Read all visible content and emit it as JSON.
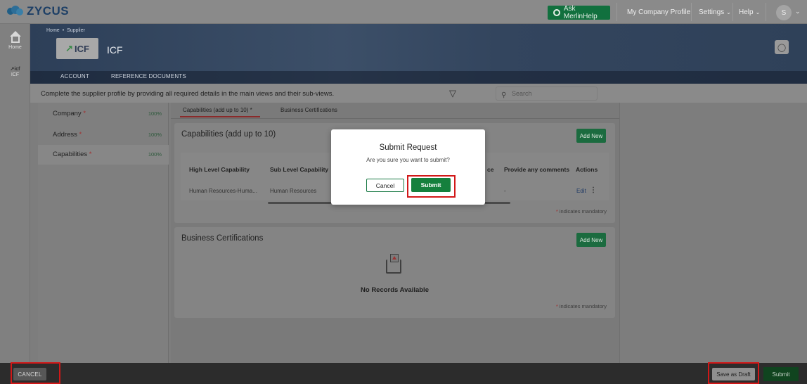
{
  "app": {
    "logo_text": "ZYCUS",
    "ask_button": "Ask MerlinHelp",
    "nav": {
      "profile": "My Company Profile",
      "settings": "Settings",
      "help": "Help"
    },
    "avatar_initial": "S"
  },
  "rail": {
    "home_label": "Home",
    "icf_label": "ICF"
  },
  "banner": {
    "breadcrumb": [
      "Home",
      "Supplier"
    ],
    "company_logo_text": "ICF",
    "company_name": "ICF",
    "tabs": [
      "ACCOUNT",
      "REFERENCE DOCUMENTS"
    ]
  },
  "instruction": {
    "text": "Complete the supplier profile by providing all required details in the main views and their sub-views.",
    "search_placeholder": "Search"
  },
  "sidebar": {
    "items": [
      {
        "label": "Company",
        "required": "*",
        "percent": "100%"
      },
      {
        "label": "Address",
        "required": "*",
        "percent": "100%"
      },
      {
        "label": "Capabilities",
        "required": "*",
        "percent": "100%"
      }
    ]
  },
  "subtabs": [
    "Capabilities (add up to 10) *",
    "Business Certifications"
  ],
  "capabilities": {
    "title": "Capabilities (add up to 10)",
    "add_new": "Add New",
    "columns": [
      "High Level Capability",
      "Sub Level Capability",
      "ce",
      "Provide any comments",
      "Actions"
    ],
    "rows": [
      {
        "high": "Human Resources-Huma...",
        "sub": "Human Resources",
        "comment": "-",
        "action": "Edit"
      }
    ],
    "mandatory_note": "indicates mandatory"
  },
  "certifications": {
    "title": "Business Certifications",
    "add_new": "Add New",
    "empty_text": "No Records Available",
    "mandatory_note": "indicates mandatory"
  },
  "bottom": {
    "cancel": "CANCEL",
    "save_draft": "Save as Draft",
    "submit": "Submit"
  },
  "modal": {
    "title": "Submit Request",
    "message": "Are you sure you want to submit?",
    "cancel": "Cancel",
    "submit": "Submit"
  },
  "colors": {
    "primary_green": "#15803d",
    "highlight_red": "#d11818"
  }
}
